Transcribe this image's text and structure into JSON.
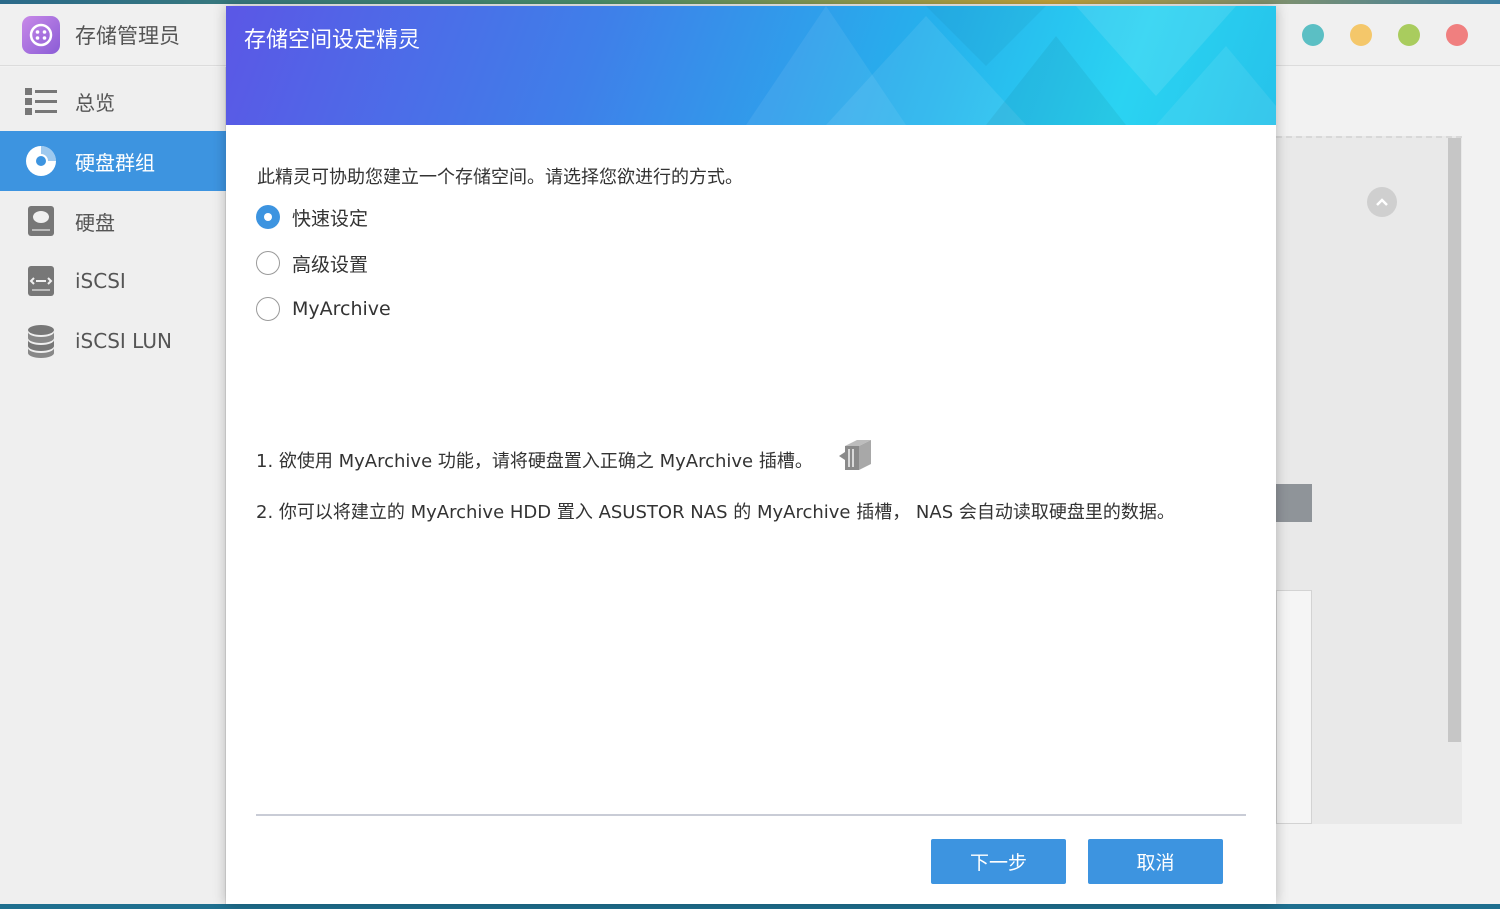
{
  "app": {
    "title": "存储管理员",
    "colors": {
      "accent": "#3d94e0"
    }
  },
  "window_controls": [
    {
      "name": "teal",
      "color": "#5bbfc4"
    },
    {
      "name": "yellow",
      "color": "#f4c76a"
    },
    {
      "name": "green",
      "color": "#a9cc5e"
    },
    {
      "name": "red",
      "color": "#f07f7f"
    }
  ],
  "sidebar": {
    "items": [
      {
        "label": "总览",
        "icon": "list-icon"
      },
      {
        "label": "硬盘群组",
        "icon": "disk-group-icon",
        "active": true
      },
      {
        "label": "硬盘",
        "icon": "hard-disk-icon"
      },
      {
        "label": "iSCSI",
        "icon": "iscsi-icon"
      },
      {
        "label": "iSCSI LUN",
        "icon": "database-icon"
      }
    ]
  },
  "dialog": {
    "title": "存储空间设定精灵",
    "intro": "此精灵可协助您建立一个存储空间。请选择您欲进行的方式。",
    "options": [
      {
        "label": "快速设定",
        "selected": true
      },
      {
        "label": "高级设置",
        "selected": false
      },
      {
        "label": "MyArchive",
        "selected": false
      }
    ],
    "notes": [
      "1. 欲使用 MyArchive 功能，请将硬盘置入正确之 MyArchive 插槽。",
      "2. 你可以将建立的 MyArchive HDD 置入 ASUSTOR NAS 的 MyArchive 插槽， NAS 会自动读取硬盘里的数据。"
    ],
    "buttons": {
      "next": "下一步",
      "cancel": "取消"
    }
  }
}
